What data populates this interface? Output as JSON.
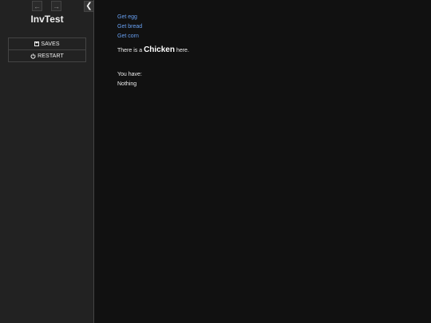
{
  "sidebar": {
    "history_back_icon": "arrow-left-icon",
    "history_forward_icon": "arrow-right-icon",
    "toggle_icon": "chevron-left-icon",
    "title": "InvTest",
    "menu": {
      "saves_label": "SAVES",
      "restart_label": "RESTART"
    }
  },
  "passage": {
    "links": [
      "Get egg",
      "Get bread",
      "Get corn"
    ],
    "description": {
      "prefix": "There is a",
      "emphasis": "Chicken",
      "suffix": "here."
    },
    "inventory": {
      "label": "You have:",
      "value": "Nothing"
    }
  },
  "colors": {
    "sidebar_bg": "#222222",
    "main_bg": "#111111",
    "link": "#68a0f2",
    "text": "#eeeeee"
  }
}
